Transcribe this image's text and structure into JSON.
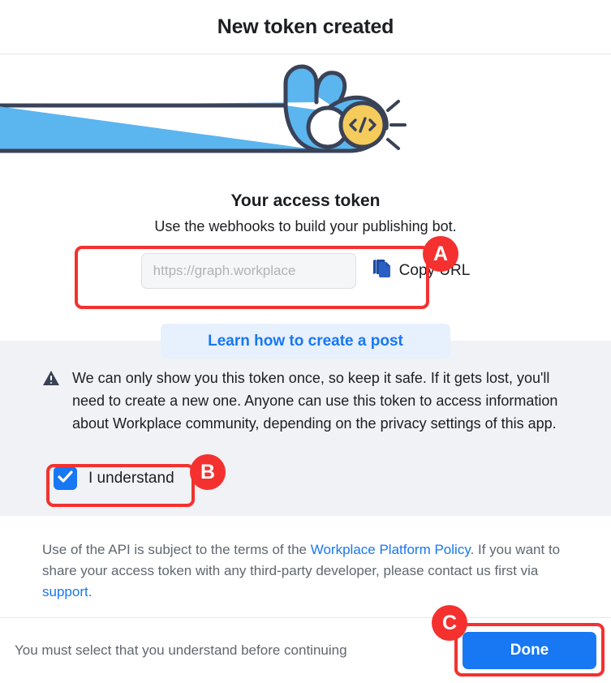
{
  "header": {
    "title": "New token created"
  },
  "illustration": {
    "name": "ok-hand-code-badge-illustration",
    "hand_color": "#5bb5ef",
    "outline_color": "#3a4257",
    "badge_color": "#f5cb5c",
    "badge_glyph": "</>"
  },
  "token": {
    "title": "Your access token",
    "subtitle": "Use the webhooks to build your publishing bot.",
    "input_placeholder": "https://graph.workplace",
    "input_value": "",
    "copy_label": "Copy URL",
    "copy_icon": "copy-icon"
  },
  "learn": {
    "label": "Learn how to create a post"
  },
  "warning": {
    "icon": "warning-triangle-icon",
    "text": "We can only show you this token once, so keep it safe. If it gets lost, you'll need to create a new one. Anyone can use this token to access information about Workplace community, depending on the privacy settings of this app.",
    "checkbox_checked": true,
    "checkbox_icon": "checkmark-icon",
    "checkbox_label": "I understand"
  },
  "api_notice": {
    "part1": "Use of the API is subject to the terms of the ",
    "link1": "Workplace Platform Policy",
    "part2": ". If you want to share your access token with any third-party developer, please contact us first via ",
    "link2": "support",
    "part3": "."
  },
  "bottom": {
    "note": "You must select that you understand before continuing",
    "done_label": "Done"
  },
  "annotations": {
    "accent_color": "#f4312f",
    "items": [
      {
        "label": "A",
        "target": "copy-url-region"
      },
      {
        "label": "B",
        "target": "i-understand-checkbox"
      },
      {
        "label": "C",
        "target": "done-button"
      }
    ]
  },
  "colors": {
    "primary_blue": "#1877f2",
    "light_blue_bg": "#e7f0fd",
    "gray_section": "#f0f2f5",
    "text_primary": "#1c1e21",
    "text_secondary": "#606770"
  }
}
